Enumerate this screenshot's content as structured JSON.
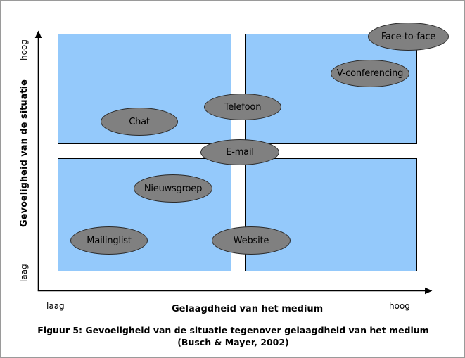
{
  "figure": {
    "caption_line1": "Figuur 5: Gevoeligheid van de situatie tegenover gelaagdheid van het medium",
    "caption_line2": "(Busch & Mayer, 2002)",
    "background_color": "#ffffff",
    "border_color": "#9a9a9a"
  },
  "chart_data": {
    "type": "scatter",
    "title": "Figuur 5: Gevoeligheid van de situatie tegenover gelaagdheid van het medium (Busch & Mayer, 2002)",
    "xlabel": "Gelaagdheid van het medium",
    "ylabel": "Gevoeligheid van de situatie",
    "x_tick_labels": [
      "laag",
      "hoog"
    ],
    "y_tick_labels": [
      "laag",
      "hoog"
    ],
    "grid": false,
    "legend": "none",
    "quadrant_fill": "#94c9fb",
    "node_fill": "#808080",
    "node_stroke": "#2b2b2b",
    "quadrants": [
      {
        "name": "top-left",
        "x_level": "laag",
        "y_level": "hoog"
      },
      {
        "name": "top-right",
        "x_level": "hoog",
        "y_level": "hoog"
      },
      {
        "name": "bottom-left",
        "x_level": "laag",
        "y_level": "laag"
      },
      {
        "name": "bottom-right",
        "x_level": "hoog",
        "y_level": "laag"
      }
    ],
    "points": [
      {
        "label": "Face-to-face",
        "x": 0.93,
        "y": 0.97,
        "quadrant": "top-right"
      },
      {
        "label": "V-conferencing",
        "x": 0.83,
        "y": 0.85,
        "quadrant": "top-right"
      },
      {
        "label": "Telefoon",
        "x": 0.51,
        "y": 0.7,
        "quadrant": "boundary-vertical"
      },
      {
        "label": "Chat",
        "x": 0.28,
        "y": 0.61,
        "quadrant": "top-left"
      },
      {
        "label": "E-mail",
        "x": 0.5,
        "y": 0.5,
        "quadrant": "center"
      },
      {
        "label": "Nieuwsgroep",
        "x": 0.36,
        "y": 0.36,
        "quadrant": "bottom-left"
      },
      {
        "label": "Mailinglist",
        "x": 0.16,
        "y": 0.16,
        "quadrant": "bottom-left"
      },
      {
        "label": "Website",
        "x": 0.52,
        "y": 0.16,
        "quadrant": "boundary-vertical"
      }
    ]
  },
  "axes": {
    "y_axis_title": "Gevoeligheid van de situatie",
    "y_tick_top": "hoog",
    "y_tick_bottom": "laag",
    "x_axis_title": "Gelaagdheid van het medium",
    "x_tick_left": "laag",
    "x_tick_right": "hoog"
  },
  "nodes": [
    {
      "id": "face-to-face",
      "label": "Face-to-face"
    },
    {
      "id": "v-conferencing",
      "label": "V-conferencing"
    },
    {
      "id": "telefoon",
      "label": "Telefoon"
    },
    {
      "id": "chat",
      "label": "Chat"
    },
    {
      "id": "e-mail",
      "label": "E-mail"
    },
    {
      "id": "nieuwsgroep",
      "label": "Nieuwsgroep"
    },
    {
      "id": "mailinglist",
      "label": "Mailinglist"
    },
    {
      "id": "website",
      "label": "Website"
    }
  ]
}
